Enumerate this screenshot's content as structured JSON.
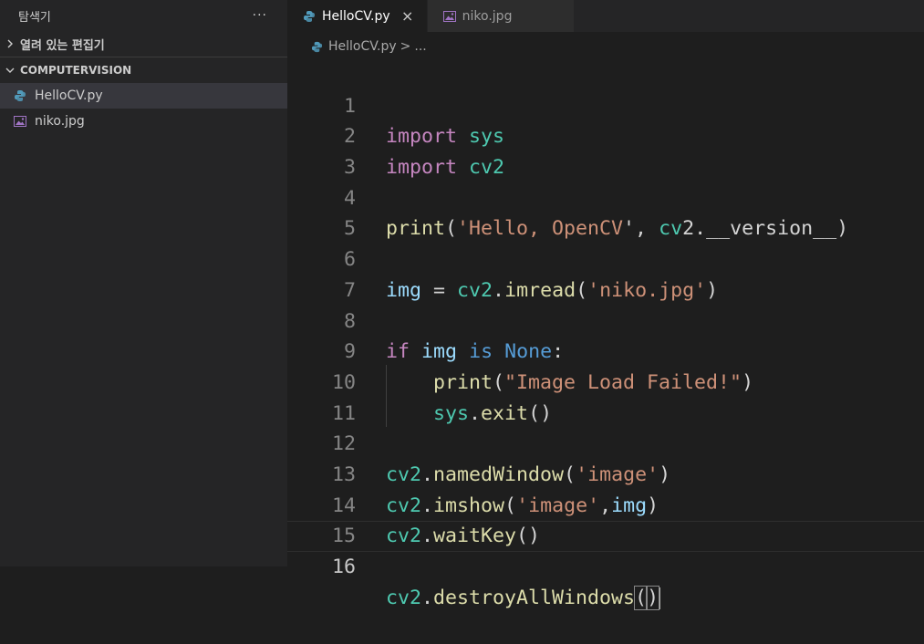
{
  "sidebar": {
    "title": "탐색기",
    "more": "···",
    "open_editors": "열려 있는 편집기",
    "folder": "COMPUTERVISION",
    "files": [
      {
        "name": "HelloCV.py",
        "icon": "python-file-icon"
      },
      {
        "name": "niko.jpg",
        "icon": "image-file-icon"
      }
    ]
  },
  "tabs": [
    {
      "label": "HelloCV.py",
      "close": "×"
    },
    {
      "label": "niko.jpg"
    }
  ],
  "breadcrumb": {
    "file": "HelloCV.py",
    "sep": ">",
    "rest": "..."
  },
  "line_numbers": [
    "1",
    "2",
    "3",
    "4",
    "5",
    "6",
    "7",
    "8",
    "9",
    "10",
    "11",
    "12",
    "13",
    "14",
    "15",
    "16"
  ],
  "code_lines": [
    "import sys",
    "import cv2",
    "",
    "print('Hello, OpenCV', cv2.__version__)",
    "",
    "img = cv2.imread('niko.jpg')",
    "",
    "if img is None:",
    "    print(\"Image Load Failed!\")",
    "    sys.exit()",
    "",
    "cv2.namedWindow('image')",
    "cv2.imshow('image',img)",
    "cv2.waitKey()",
    "",
    "cv2.destroyAllWindows()"
  ],
  "colors": {
    "keyword": "#c586c0",
    "module": "#4ec9b0",
    "function": "#dcdcaa",
    "string": "#ce9178",
    "variable": "#9cdcfe",
    "constant": "#569cd6"
  }
}
